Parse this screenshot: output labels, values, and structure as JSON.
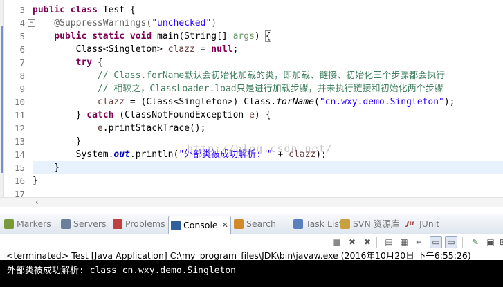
{
  "editor": {
    "line_numbers": [
      "3",
      "4",
      "5",
      "6",
      "7",
      "8",
      "9",
      "10",
      "11",
      "12",
      "13",
      "14",
      "15",
      "16",
      "17"
    ],
    "lines": [
      [
        {
          "t": "public class",
          "c": "kw"
        },
        {
          "t": " Test {",
          "c": ""
        }
      ],
      [
        {
          "t": "    @SuppressWarnings(",
          "c": "ann"
        },
        {
          "t": "\"unchecked\"",
          "c": "str"
        },
        {
          "t": ")",
          "c": "ann"
        }
      ],
      [
        {
          "t": "    public static void",
          "c": "kw"
        },
        {
          "t": " main(String[] ",
          "c": ""
        },
        {
          "t": "args",
          "c": "unused"
        },
        {
          "t": ") ",
          "c": ""
        },
        {
          "t": "{",
          "c": "bracket"
        }
      ],
      [
        {
          "t": "        Class<Singleton> ",
          "c": ""
        },
        {
          "t": "clazz",
          "c": "var"
        },
        {
          "t": " = ",
          "c": ""
        },
        {
          "t": "null",
          "c": "kw"
        },
        {
          "t": ";",
          "c": ""
        }
      ],
      [
        {
          "t": "        try",
          "c": "kw"
        },
        {
          "t": " {",
          "c": ""
        }
      ],
      [
        {
          "t": "            // Class.forName默认会初始化加载的类，即加载、链接、初始化三个步骤都会执行",
          "c": "cmt"
        }
      ],
      [
        {
          "t": "            // 相较之，ClassLoader.load只是进行加载步骤，并未执行链接和初始化两个步骤",
          "c": "cmt"
        }
      ],
      [
        {
          "t": "            ",
          "c": ""
        },
        {
          "t": "clazz",
          "c": "var"
        },
        {
          "t": " = (Class<Singleton>) Class.",
          "c": ""
        },
        {
          "t": "forName",
          "c": "ital"
        },
        {
          "t": "(",
          "c": ""
        },
        {
          "t": "\"cn.wxy.demo.Singleton\"",
          "c": "str"
        },
        {
          "t": ");",
          "c": ""
        }
      ],
      [
        {
          "t": "        } ",
          "c": ""
        },
        {
          "t": "catch",
          "c": "kw"
        },
        {
          "t": " (ClassNotFoundException ",
          "c": ""
        },
        {
          "t": "e",
          "c": "var"
        },
        {
          "t": ") {",
          "c": ""
        }
      ],
      [
        {
          "t": "            ",
          "c": ""
        },
        {
          "t": "e",
          "c": "var"
        },
        {
          "t": ".printStackTrace();",
          "c": ""
        }
      ],
      [
        {
          "t": "        }",
          "c": ""
        }
      ],
      [
        {
          "t": "        System.",
          "c": ""
        },
        {
          "t": "out",
          "c": "sfld"
        },
        {
          "t": ".println(",
          "c": ""
        },
        {
          "t": "\"外部类被成功解析: \"",
          "c": "str"
        },
        {
          "t": " + ",
          "c": ""
        },
        {
          "t": "clazz",
          "c": "var"
        },
        {
          "t": ");",
          "c": ""
        }
      ],
      [
        {
          "t": "    }",
          "c": ""
        }
      ],
      [
        {
          "t": "}",
          "c": ""
        }
      ],
      [
        {
          "t": "",
          "c": ""
        }
      ]
    ],
    "current_line_index": 12,
    "watermark": "http://blog.csdn.net/"
  },
  "tabs": [
    {
      "name": "markers",
      "label": "Markers",
      "icon": "markers-icon",
      "color": "#7a9a3a"
    },
    {
      "name": "servers",
      "label": "Servers",
      "icon": "servers-icon",
      "color": "#6b7f9a"
    },
    {
      "name": "problems",
      "label": "Problems",
      "icon": "problems-icon",
      "color": "#c04040"
    },
    {
      "name": "console",
      "label": "Console",
      "icon": "console-icon",
      "color": "#2f5f9f",
      "active": true,
      "close": "✕"
    },
    {
      "name": "search",
      "label": "Search",
      "icon": "search-icon",
      "color": "#d08a2a"
    },
    {
      "name": "tasklist",
      "label": "Task List",
      "icon": "tasklist-icon",
      "color": "#5a7fbf"
    },
    {
      "name": "svn",
      "label": "SVN 资源库",
      "icon": "svn-icon",
      "color": "#c8a040"
    },
    {
      "name": "junit",
      "label": "JUnit",
      "icon": "junit-icon",
      "color": "#a04040",
      "glyph": "Ju"
    }
  ],
  "console": {
    "process_label": "<terminated> Test [Java Application] C:\\my_program_files\\JDK\\bin\\javaw.exe (2016年10月20日 下午6:55:26)",
    "output": "外部类被成功解析: class cn.wxy.demo.Singleton",
    "toolbar": [
      {
        "name": "terminate-button",
        "glyph": "■",
        "icon": "stop-icon"
      },
      {
        "name": "remove-launch-button",
        "glyph": "✖",
        "icon": "remove-icon"
      },
      {
        "name": "remove-all-button",
        "glyph": "✖",
        "icon": "remove-all-icon"
      },
      {
        "name": "clear-console-button",
        "glyph": "▤",
        "icon": "clear-icon"
      },
      {
        "name": "scroll-lock-button",
        "glyph": "▦",
        "icon": "scroll-lock-icon"
      },
      {
        "name": "word-wrap-button",
        "glyph": "↵",
        "icon": "wrap-icon"
      },
      {
        "name": "show-on-out-button",
        "glyph": "▭",
        "icon": "show-out-icon",
        "pressed": true
      },
      {
        "name": "show-on-err-button",
        "glyph": "▭",
        "icon": "show-err-icon",
        "pressed": true
      },
      {
        "name": "pin-console-button",
        "glyph": "✎",
        "icon": "pin-icon"
      },
      {
        "name": "display-console-button",
        "glyph": "▣",
        "icon": "display-console-icon"
      },
      {
        "name": "open-console-button",
        "glyph": "⊞",
        "icon": "open-console-icon"
      }
    ]
  }
}
